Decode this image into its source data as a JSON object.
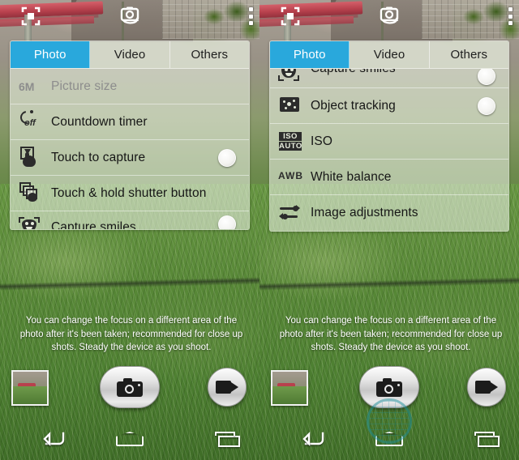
{
  "app": {
    "name": "Camera",
    "tabs": [
      {
        "label": "Photo",
        "active": true
      },
      {
        "label": "Video",
        "active": false
      },
      {
        "label": "Others",
        "active": false
      }
    ],
    "topbar": {
      "frame_icon": "frame-crop-icon",
      "switch_camera_icon": "switch-camera-icon",
      "overflow_icon": "more-vertical-icon"
    },
    "hint_text": "You can change the focus on a different area of the photo after it's been taken; recommended for close up shots. Steady the device as you shoot.",
    "controls": {
      "thumbnail_label": "Last photo thumbnail",
      "shutter_label": "Shutter",
      "video_label": "Record video"
    },
    "navbar": {
      "back_label": "Back",
      "home_label": "Home",
      "recents_label": "Recents"
    },
    "watermark_text": "",
    "accent_color": "#29a8dc",
    "panel_tint": "rgba(236,240,228,0.40)"
  },
  "left_screen": {
    "scroll_position": "top",
    "settings": [
      {
        "label": "Picture size",
        "icon": "picture-size-icon",
        "tag": "6M",
        "disabled": true,
        "toggle": false
      },
      {
        "label": "Countdown timer",
        "icon": "countdown-timer-icon",
        "value": "off",
        "disabled": false,
        "toggle": false
      },
      {
        "label": "Touch to capture",
        "icon": "touch-to-capture-icon",
        "disabled": false,
        "toggle": true
      },
      {
        "label": "Touch & hold shutter button",
        "icon": "touch-hold-shutter-icon",
        "disabled": false,
        "toggle": false
      },
      {
        "label": "Capture smiles",
        "icon": "capture-smiles-icon",
        "disabled": false,
        "toggle": true
      }
    ]
  },
  "right_screen": {
    "scroll_position": "bottom",
    "settings": [
      {
        "label": "Capture smiles",
        "icon": "capture-smiles-icon",
        "disabled": false,
        "toggle": true
      },
      {
        "label": "Object tracking",
        "icon": "object-tracking-icon",
        "disabled": false,
        "toggle": true
      },
      {
        "label": "ISO",
        "icon": "iso-auto-icon",
        "value_top": "ISO",
        "value_bottom": "AUTO",
        "disabled": false,
        "toggle": false
      },
      {
        "label": "White balance",
        "icon": "white-balance-icon",
        "value": "AWB",
        "disabled": false,
        "toggle": false
      },
      {
        "label": "Image adjustments",
        "icon": "image-adjustments-icon",
        "disabled": false,
        "toggle": false
      }
    ]
  }
}
